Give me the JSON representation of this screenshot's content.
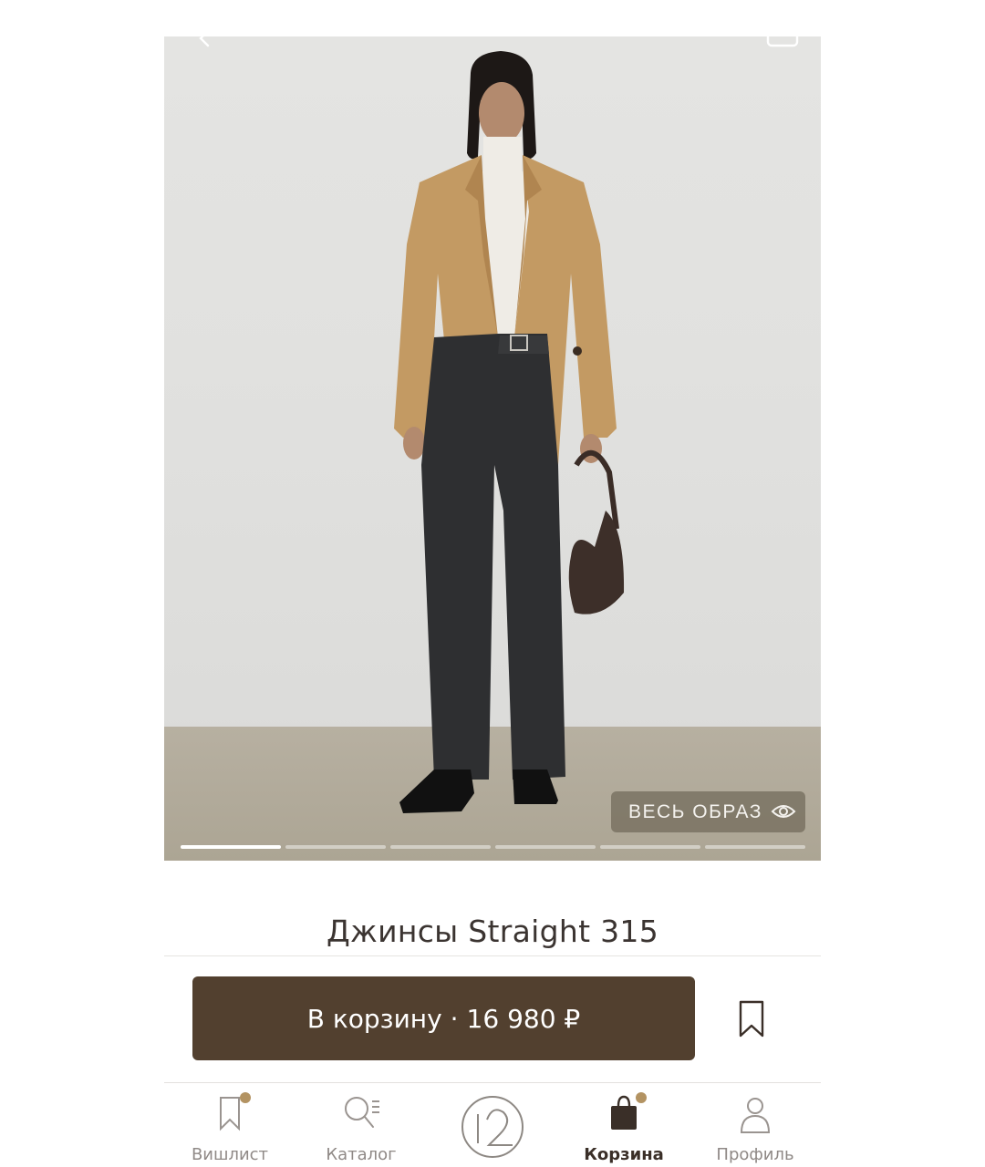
{
  "product": {
    "title": "Джинсы Straight 315",
    "look_label": "ВЕСЬ ОБРАЗ",
    "image_count": 6,
    "active_image": 1
  },
  "actions": {
    "cart_label": "В корзину",
    "separator": "·",
    "price": "16 980 ₽",
    "button_color": "#52402f"
  },
  "tabs": [
    {
      "label": "Вишлист",
      "icon": "bookmark-icon",
      "badge": true,
      "active": false
    },
    {
      "label": "Каталог",
      "icon": "catalog-search-icon",
      "badge": false,
      "active": false
    },
    {
      "label": "",
      "icon": "brand-logo-12",
      "badge": false,
      "active": false
    },
    {
      "label": "Корзина",
      "icon": "shopping-bag-icon",
      "badge": true,
      "active": true
    },
    {
      "label": "Профиль",
      "icon": "profile-icon",
      "badge": false,
      "active": false
    }
  ],
  "colors": {
    "accent_dot": "#b39362",
    "active_tab": "#3a2f28",
    "inactive_tab": "#8f8986"
  }
}
